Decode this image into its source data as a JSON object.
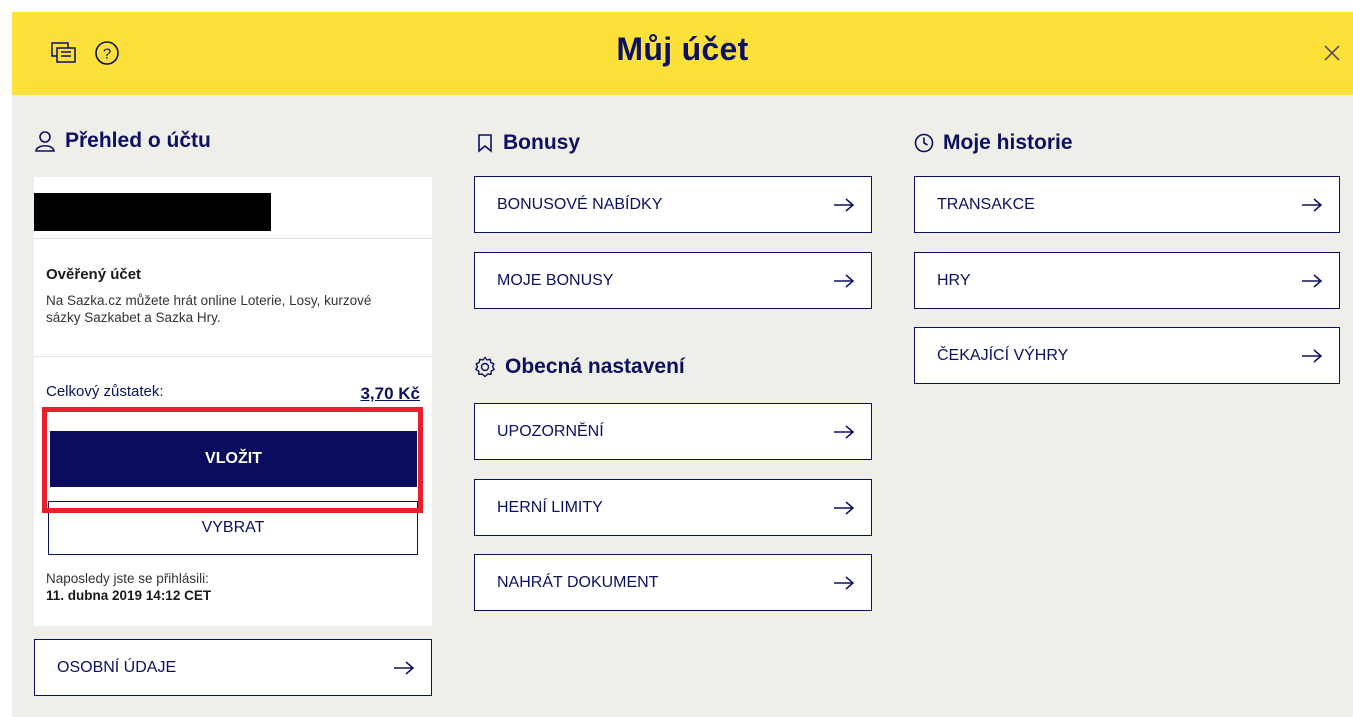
{
  "header": {
    "title": "Můj účet",
    "chat_icon": "chat-icon",
    "help_icon": "help-icon",
    "close_icon": "close-icon",
    "background_color": "#fde13a",
    "text_color": "#0b1060"
  },
  "account_overview": {
    "heading": "Přehled o účtu",
    "icon": "user-icon",
    "verified_title": "Ověřený účet",
    "verified_text": "Na Sazka.cz můžete hrát online Loterie, Losy, kurzové sázky Sazkabet a Sazka Hry.",
    "balance_label": "Celkový zůstatek:",
    "balance_value": "3,70 Kč",
    "deposit_label": "VLOŽIT",
    "withdraw_label": "VYBRAT",
    "last_login_label": "Naposledy jste se přihlásili:",
    "last_login_value": "11. dubna 2019 14:12 CET",
    "personal_data_label": "OSOBNÍ ÚDAJE"
  },
  "bonuses": {
    "heading": "Bonusy",
    "icon": "bookmark-icon",
    "items": [
      "BONUSOVÉ NABÍDKY",
      "MOJE BONUSY"
    ]
  },
  "general_settings": {
    "heading": "Obecná nastavení",
    "icon": "gear-icon",
    "items": [
      "UPOZORNĚNÍ",
      "HERNÍ LIMITY",
      "NAHRÁT DOKUMENT"
    ]
  },
  "history": {
    "heading": "Moje historie",
    "icon": "clock-icon",
    "items": [
      "TRANSAKCE",
      "HRY",
      "ČEKAJÍCÍ VÝHRY"
    ]
  },
  "colors": {
    "primary": "#0b1060",
    "deposit_button": "#0b0c5e",
    "highlight": "#e8202e",
    "panel_background": "#efeee9"
  }
}
